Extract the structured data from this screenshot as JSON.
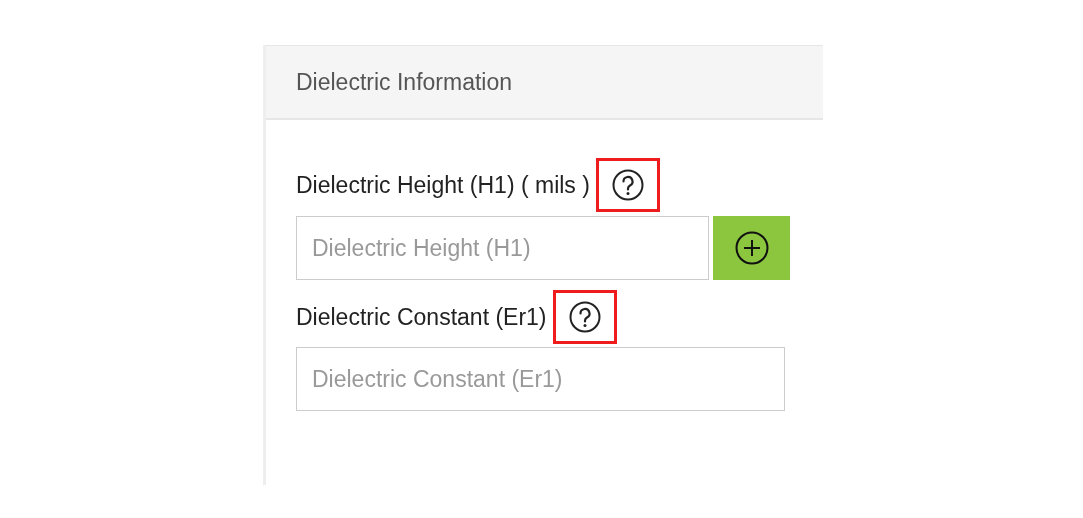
{
  "panel": {
    "title": "Dielectric Information"
  },
  "fields": [
    {
      "label": "Dielectric Height (H1) ( mils )",
      "help_highlighted": true,
      "placeholder": "Dielectric Height (H1)",
      "add_button": true
    },
    {
      "label": "Dielectric Constant (Er1)",
      "help_highlighted": true,
      "placeholder": "Dielectric Constant (Er1)",
      "add_button": false
    }
  ]
}
